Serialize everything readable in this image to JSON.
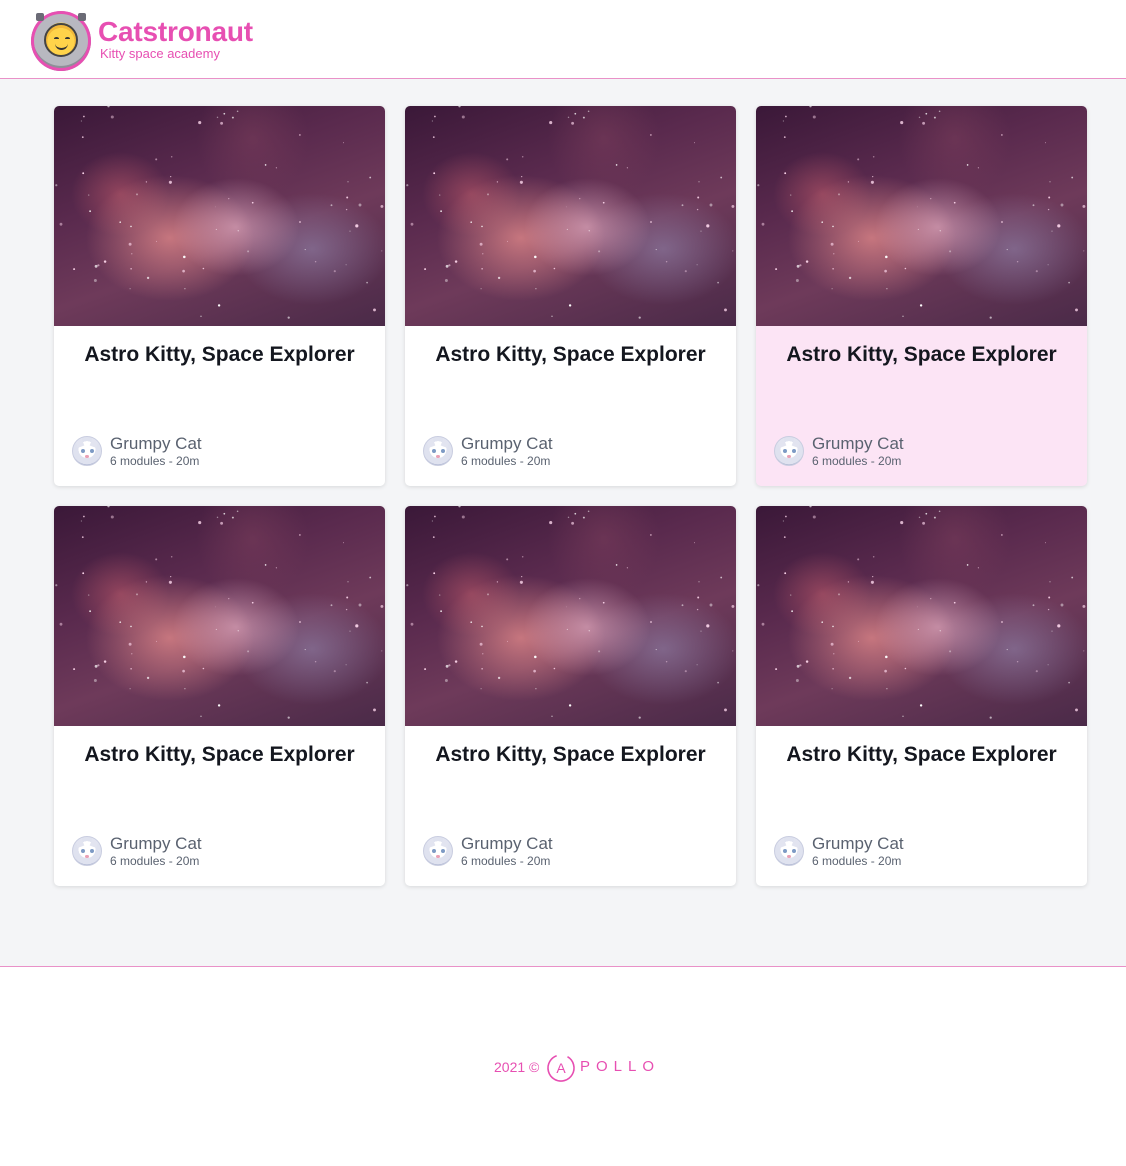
{
  "header": {
    "brand_title": "Catstronaut",
    "brand_subtitle": "Kitty space academy"
  },
  "colors": {
    "brand": "#e74fb2",
    "card_highlight": "#fce4f5",
    "page_bg": "#f4f5f7"
  },
  "tracks": [
    {
      "title": "Astro Kitty, Space Explorer",
      "author": "Grumpy Cat",
      "meta": "6 modules - 20m",
      "highlighted": false
    },
    {
      "title": "Astro Kitty, Space Explorer",
      "author": "Grumpy Cat",
      "meta": "6 modules - 20m",
      "highlighted": false
    },
    {
      "title": "Astro Kitty, Space Explorer",
      "author": "Grumpy Cat",
      "meta": "6 modules - 20m",
      "highlighted": true
    },
    {
      "title": "Astro Kitty, Space Explorer",
      "author": "Grumpy Cat",
      "meta": "6 modules - 20m",
      "highlighted": false
    },
    {
      "title": "Astro Kitty, Space Explorer",
      "author": "Grumpy Cat",
      "meta": "6 modules - 20m",
      "highlighted": false
    },
    {
      "title": "Astro Kitty, Space Explorer",
      "author": "Grumpy Cat",
      "meta": "6 modules - 20m",
      "highlighted": false
    }
  ],
  "footer": {
    "copyright": "2021 ©",
    "apollo_letter": "A",
    "apollo_rest": "POLLO"
  },
  "icons": {
    "logo": "catstronaut-logo-icon",
    "avatar": "grumpy-cat-avatar",
    "footer_logo": "apollo-logo-icon"
  }
}
